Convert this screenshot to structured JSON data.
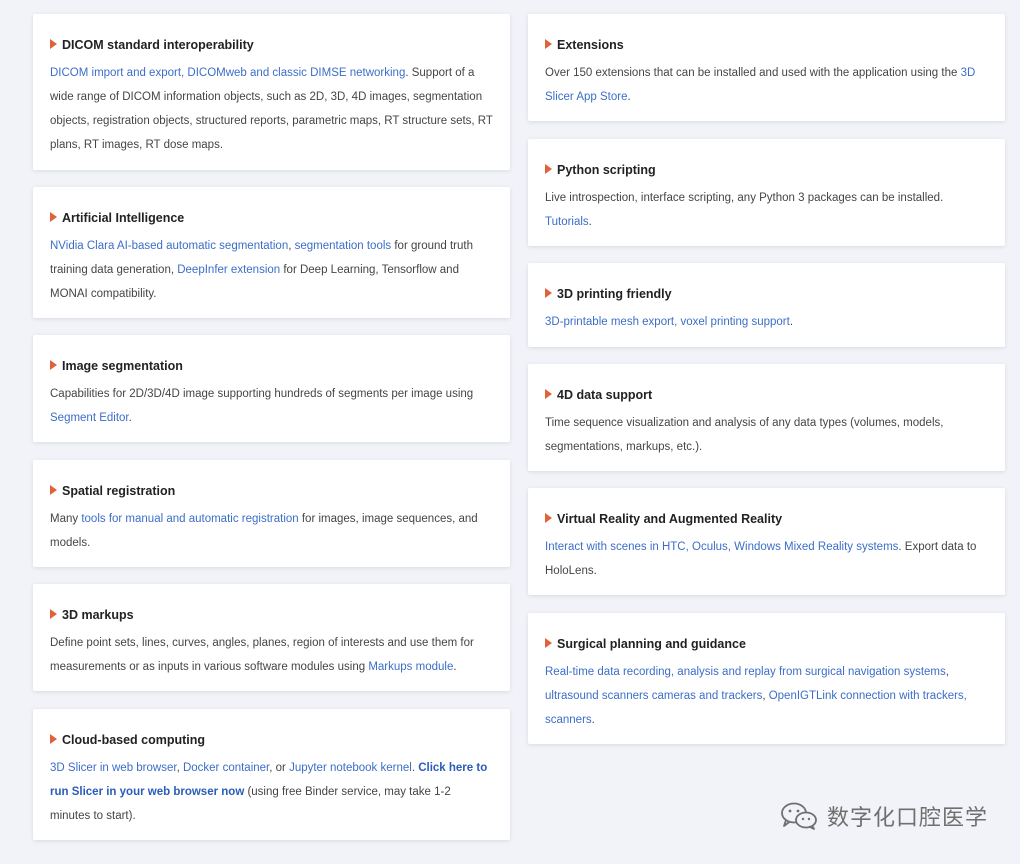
{
  "cards": [
    {
      "title": "DICOM standard interoperability",
      "segments": [
        {
          "text": "DICOM import and export, DICOMweb and classic DIMSE networking",
          "link": true
        },
        {
          "text": ". Support of a wide range of DICOM information objects, such as 2D, 3D, 4D images, segmentation objects, registration objects, structured reports, parametric maps, RT structure sets, RT plans, RT images, RT dose maps.",
          "link": false
        }
      ]
    },
    {
      "title": "Artificial Intelligence",
      "segments": [
        {
          "text": "NVidia Clara AI-based automatic segmentation",
          "link": true
        },
        {
          "text": ", ",
          "link": false
        },
        {
          "text": "segmentation tools",
          "link": true
        },
        {
          "text": " for ground truth training data generation, ",
          "link": false
        },
        {
          "text": "DeepInfer extension",
          "link": true
        },
        {
          "text": " for Deep Learning, Tensorflow and MONAI compatibility.",
          "link": false
        }
      ]
    },
    {
      "title": "Image segmentation",
      "segments": [
        {
          "text": "Capabilities for 2D/3D/4D image supporting hundreds of segments per image using ",
          "link": false
        },
        {
          "text": "Segment Editor",
          "link": true
        },
        {
          "text": ".",
          "link": false
        }
      ]
    },
    {
      "title": "Spatial registration",
      "segments": [
        {
          "text": "Many ",
          "link": false
        },
        {
          "text": "tools for manual and automatic registration",
          "link": true
        },
        {
          "text": " for images, image sequences, and models.",
          "link": false
        }
      ]
    },
    {
      "title": "3D markups",
      "segments": [
        {
          "text": "Define point sets, lines, curves, angles, planes, region of interests and use them for measurements or as inputs in various software modules using ",
          "link": false
        },
        {
          "text": "Markups module",
          "link": true
        },
        {
          "text": ".",
          "link": false
        }
      ]
    },
    {
      "title": "Cloud-based computing",
      "segments": [
        {
          "text": "3D Slicer in web browser",
          "link": true
        },
        {
          "text": ", ",
          "link": false
        },
        {
          "text": "Docker container",
          "link": true
        },
        {
          "text": ", or ",
          "link": false
        },
        {
          "text": "Jupyter notebook kernel",
          "link": true
        },
        {
          "text": ". ",
          "link": false
        },
        {
          "text": "Click here to run Slicer in your web browser now",
          "link": "strong"
        },
        {
          "text": " (using free Binder service, may take 1-2 minutes to start).",
          "link": false
        }
      ]
    },
    {
      "title": "Extensions",
      "segments": [
        {
          "text": "Over 150 extensions that can be installed and used with the application using the ",
          "link": false
        },
        {
          "text": "3D Slicer App Store",
          "link": true
        },
        {
          "text": ".",
          "link": false
        }
      ]
    },
    {
      "title": "Python scripting",
      "segments": [
        {
          "text": "Live introspection, interface scripting, any Python 3 packages can be installed. ",
          "link": false
        },
        {
          "text": "Tutorials",
          "link": true
        },
        {
          "text": ".",
          "link": false
        }
      ]
    },
    {
      "title": "3D printing friendly",
      "segments": [
        {
          "text": "3D-printable mesh export, voxel printing support",
          "link": true
        },
        {
          "text": ".",
          "link": false
        }
      ]
    },
    {
      "title": "4D data support",
      "segments": [
        {
          "text": "Time sequence visualization and analysis of any data types (volumes, models, segmentations, markups, etc.).",
          "link": false
        }
      ]
    },
    {
      "title": "Virtual Reality and Augmented Reality",
      "segments": [
        {
          "text": "Interact with scenes in HTC, Oculus, Windows Mixed Reality systems",
          "link": true
        },
        {
          "text": ". Export data to HoloLens.",
          "link": false
        }
      ]
    },
    {
      "title": "Surgical planning and guidance",
      "segments": [
        {
          "text": "Real-time data recording, analysis and replay from surgical navigation systems",
          "link": true
        },
        {
          "text": ", ",
          "link": false
        },
        {
          "text": "ultrasound scanners cameras and trackers",
          "link": true
        },
        {
          "text": ", ",
          "link": false
        },
        {
          "text": "OpenIGTLink connection with trackers, scanners",
          "link": true
        },
        {
          "text": ".",
          "link": false
        }
      ]
    }
  ],
  "watermark": {
    "icon": "wechat-icon",
    "text": "数字化口腔医学"
  },
  "colors": {
    "page_bg": "#f1f3f8",
    "card_bg": "#ffffff",
    "accent_triangle": "#e0623a",
    "link": "#3c6ec8",
    "title": "#222222",
    "body_text": "#454545"
  }
}
